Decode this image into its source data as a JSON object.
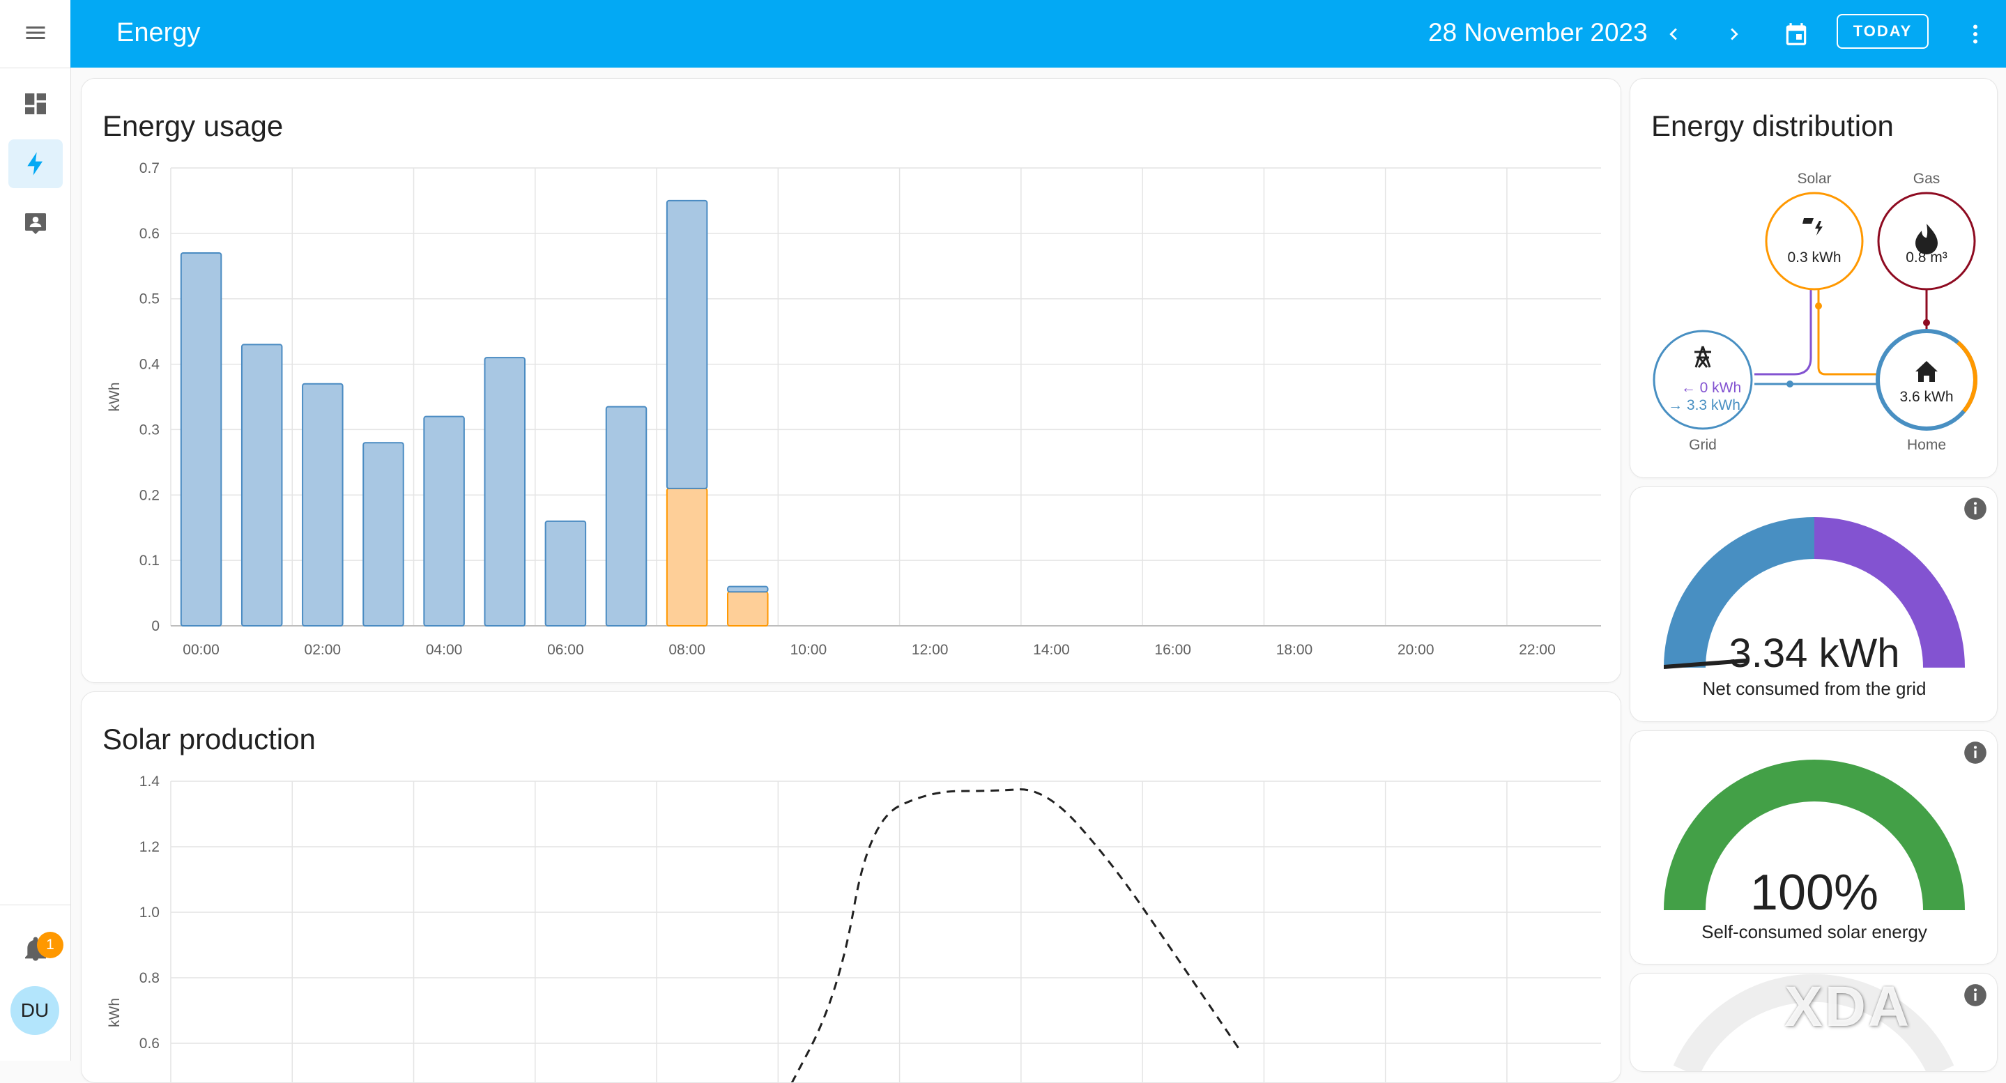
{
  "app": {
    "title": "Energy",
    "date": "28 November 2023",
    "today_label": "TODAY"
  },
  "sidebar": {
    "items": [
      {
        "name": "menu",
        "icon": "menu-icon"
      },
      {
        "name": "overview",
        "icon": "dashboard-icon"
      },
      {
        "name": "energy",
        "icon": "lightning-bolt-icon",
        "active": true
      },
      {
        "name": "logbook",
        "icon": "account-box-icon"
      }
    ],
    "notifications": {
      "count": "1"
    },
    "user": {
      "initials": "DU"
    }
  },
  "energy_usage": {
    "title": "Energy usage",
    "chart_data": {
      "type": "bar",
      "stacked": true,
      "ylabel": "kWh",
      "ylim": [
        0,
        0.7
      ],
      "yticks": [
        "0",
        "0.1",
        "0.2",
        "0.3",
        "0.4",
        "0.5",
        "0.6",
        "0.7"
      ],
      "xticks": [
        "00:00",
        "02:00",
        "04:00",
        "06:00",
        "08:00",
        "10:00",
        "12:00",
        "14:00",
        "16:00",
        "18:00",
        "20:00",
        "22:00"
      ],
      "categories": [
        "00:00",
        "01:00",
        "02:00",
        "03:00",
        "04:00",
        "05:00",
        "06:00",
        "07:00",
        "08:00",
        "09:00"
      ],
      "series": [
        {
          "color": "#a8c7e3",
          "stroke": "#4a8bc2",
          "values": [
            0.57,
            0.43,
            0.37,
            0.28,
            0.32,
            0.41,
            0.16,
            0.335,
            0.44,
            0.008
          ]
        },
        {
          "color": "#fecf98",
          "stroke": "#ff9800",
          "values": [
            0,
            0,
            0,
            0,
            0,
            0,
            0,
            0,
            0.21,
            0.052
          ]
        }
      ]
    }
  },
  "solar_production": {
    "title": "Solar production",
    "chart_data": {
      "type": "line",
      "ylabel": "kWh",
      "yticks": [
        "0.6",
        "0.8",
        "1.0",
        "1.2",
        "1.4"
      ],
      "style": "dashed",
      "color": "#212121",
      "points": [
        [
          10.0,
          0.4
        ],
        [
          11.0,
          0.75
        ],
        [
          11.5,
          1.28
        ],
        [
          12.5,
          1.37
        ],
        [
          13.5,
          1.37
        ],
        [
          14.4,
          1.38
        ],
        [
          15.5,
          1.15
        ],
        [
          16.5,
          0.88
        ],
        [
          17.6,
          0.58
        ]
      ]
    }
  },
  "energy_distribution": {
    "title": "Energy distribution",
    "solar": {
      "label": "Solar",
      "value": "0.3 kWh",
      "color": "#ff9800"
    },
    "gas": {
      "label": "Gas",
      "value": "0.8 m³",
      "color": "#8e0b21"
    },
    "grid": {
      "label": "Grid",
      "from_value": "0 kWh",
      "to_value": "3.3 kWh",
      "color": "#488fc2",
      "return_color": "#8353d1"
    },
    "home": {
      "label": "Home",
      "value": "3.6 kWh",
      "color": "#488fc2"
    }
  },
  "grid_gauge": {
    "value": "3.34 kWh",
    "caption": "Net consumed from the grid",
    "colors": {
      "consumed": "#488fc2",
      "returned": "#8353d1"
    }
  },
  "solar_gauge": {
    "value": "100%",
    "caption": "Self-consumed solar energy",
    "fraction": 1.0,
    "color": "#43a047"
  },
  "watermark": "XDA"
}
